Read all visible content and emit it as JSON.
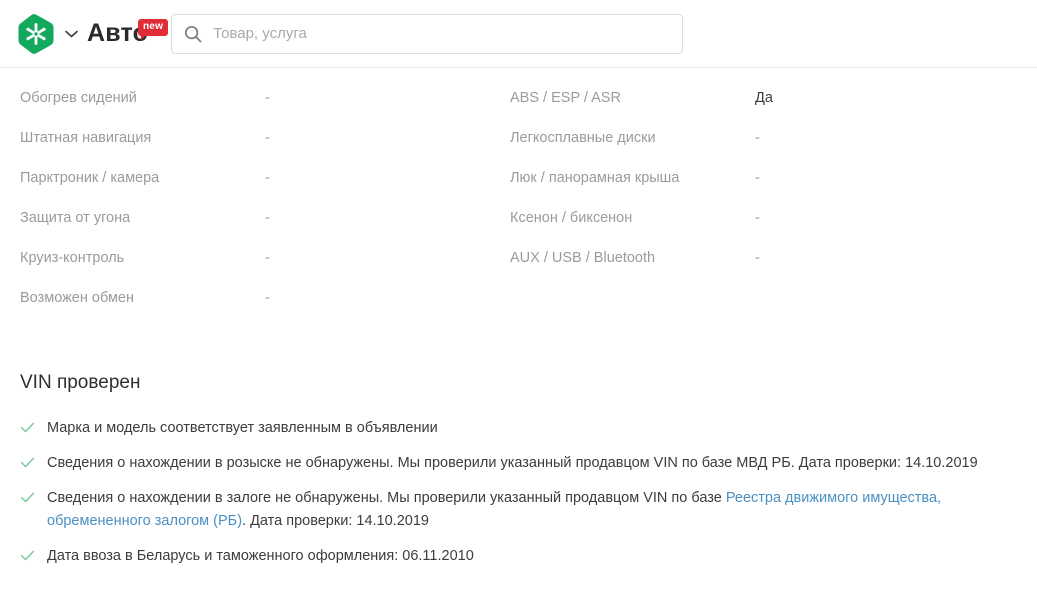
{
  "header": {
    "logo_icon": "kufar-hexagon-logo",
    "chevron_icon": "chevron-down-icon",
    "brand_name": "Авто",
    "new_badge": "new",
    "search": {
      "icon": "search-icon",
      "placeholder": "Товар, услуга",
      "value": ""
    }
  },
  "specs": {
    "left_column": [
      {
        "label": "Обогрев сидений",
        "value": "-"
      },
      {
        "label": "Штатная навигация",
        "value": "-"
      },
      {
        "label": "Парктроник / камера",
        "value": "-"
      },
      {
        "label": "Защита от угона",
        "value": "-"
      },
      {
        "label": "Круиз-контроль",
        "value": "-"
      },
      {
        "label": "Возможен обмен",
        "value": "-"
      }
    ],
    "right_column": [
      {
        "label": "ABS / ESP / ASR",
        "value": "Да"
      },
      {
        "label": "Легкосплавные диски",
        "value": "-"
      },
      {
        "label": "Люк / панорамная крыша",
        "value": "-"
      },
      {
        "label": "Ксенон / биксенон",
        "value": "-"
      },
      {
        "label": "AUX / USB / Bluetooth",
        "value": "-"
      }
    ]
  },
  "vin": {
    "title": "VIN проверен",
    "check_icon": "check-icon",
    "items": [
      {
        "pre": "Марка и модель соответствует заявленным в объявлении",
        "link": "",
        "post": ""
      },
      {
        "pre": "Сведения о нахождении в розыске не обнаружены. Мы проверили указанный продавцом VIN по базе МВД РБ. Дата проверки: 14.10.2019",
        "link": "",
        "post": ""
      },
      {
        "pre": "Сведения о нахождении в залоге не обнаружены. Мы проверили указанный продавцом VIN по базе ",
        "link": "Реестра движимого имущества, обремененного залогом (РБ)",
        "post": ". Дата проверки: 14.10.2019"
      },
      {
        "pre": "Дата ввоза в Беларусь и таможенного оформления: 06.11.2010",
        "link": "",
        "post": ""
      }
    ]
  },
  "colors": {
    "brand_green": "#12a95c",
    "badge_red": "#e02d36",
    "link_blue": "#4a90c4",
    "check_green": "#7cc7a0",
    "label_gray": "#9b9b9b",
    "text_dark": "#3c3c3c"
  }
}
